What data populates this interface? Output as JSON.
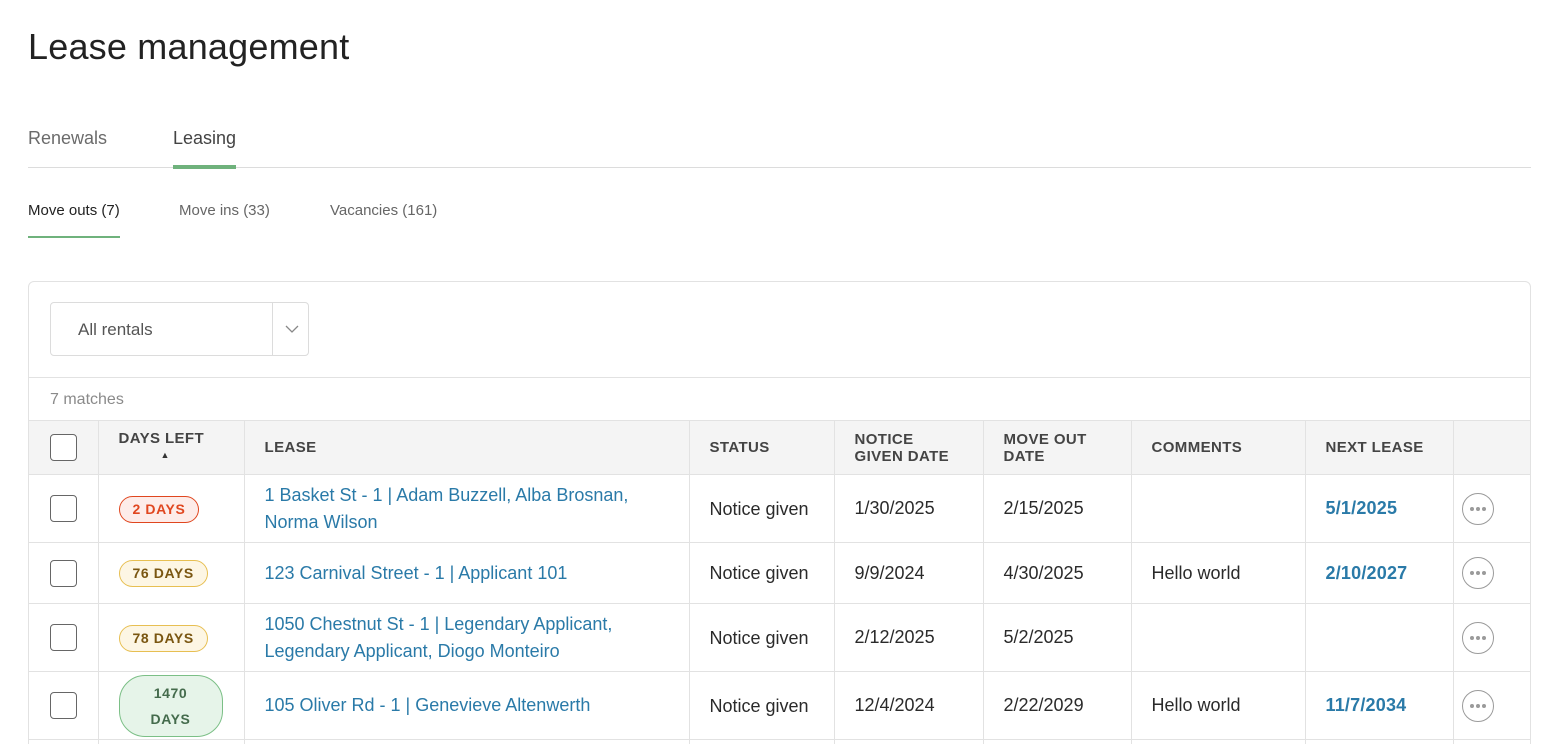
{
  "page": {
    "title": "Lease management"
  },
  "tabs": [
    {
      "label": "Renewals",
      "active": false
    },
    {
      "label": "Leasing",
      "active": true
    }
  ],
  "subtabs": [
    {
      "label": "Move outs (7)",
      "active": true
    },
    {
      "label": "Move ins (33)",
      "active": false
    },
    {
      "label": "Vacancies (161)",
      "active": false
    }
  ],
  "filter": {
    "value": "All rentals",
    "icon": "chevron-down-icon"
  },
  "matches": "7 matches",
  "table": {
    "headers": {
      "days_left": "DAYS LEFT",
      "lease": "LEASE",
      "status": "STATUS",
      "notice_given_date": "NOTICE GIVEN DATE",
      "move_out_date": "MOVE OUT DATE",
      "comments": "COMMENTS",
      "next_lease": "NEXT LEASE"
    },
    "sort": {
      "column": "days_left",
      "direction": "ascending",
      "icon": "sort-up-icon"
    },
    "rows": [
      {
        "days_left": "2 DAYS",
        "badge": "red",
        "lease": "1 Basket St - 1 | Adam Buzzell, Alba Brosnan, Norma Wilson",
        "status": "Notice given",
        "notice_given_date": "1/30/2025",
        "move_out_date": "2/15/2025",
        "comments": "",
        "next_lease": "5/1/2025"
      },
      {
        "days_left": "76 DAYS",
        "badge": "amber",
        "lease": "123 Carnival Street - 1 | Applicant 101",
        "status": "Notice given",
        "notice_given_date": "9/9/2024",
        "move_out_date": "4/30/2025",
        "comments": "Hello world",
        "next_lease": "2/10/2027"
      },
      {
        "days_left": "78 DAYS",
        "badge": "amber",
        "lease": "1050 Chestnut St - 1 | Legendary Applicant, Legendary Applicant, Diogo Monteiro",
        "status": "Notice given",
        "notice_given_date": "2/12/2025",
        "move_out_date": "5/2/2025",
        "comments": "",
        "next_lease": ""
      },
      {
        "days_left": "1470 DAYS",
        "badge": "green",
        "lease": "105 Oliver Rd - 1 | Genevieve Altenwerth",
        "status": "Notice given",
        "notice_given_date": "12/4/2024",
        "move_out_date": "2/22/2029",
        "comments": "Hello world",
        "next_lease": "11/7/2034"
      }
    ]
  },
  "colors": {
    "accent_green": "#6fb27c",
    "link_blue": "#2a7aa8",
    "badge_red": "#e0461f",
    "badge_amber": "#e7bf52",
    "badge_green": "#7bbf86"
  }
}
